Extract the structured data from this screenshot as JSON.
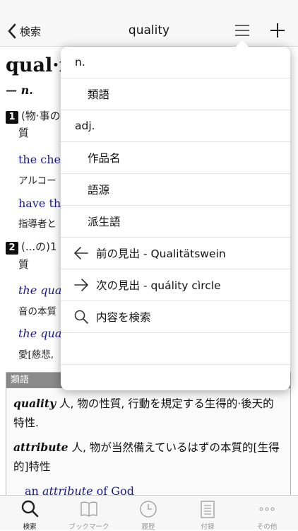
{
  "navbar": {
    "back_label": "検索",
    "title": "quality"
  },
  "entry": {
    "headword": "qual·i",
    "pos": "— n.",
    "sense1_num": "1",
    "sense1_text": "(物·事の",
    "sense1_cont": "質",
    "ex1_en": "the chem",
    "ex1_ja": "アルコー",
    "ex2_en": "have the",
    "ex2_ja": "指導者と",
    "sense2_num": "2",
    "sense2_text": "(...の)1",
    "sense2_cont": "質",
    "ex3_en": "the qual",
    "ex3_ja": "音の本質",
    "ex4_en": "the qual",
    "ex4_ja": "愛[慈悲,"
  },
  "synonyms": {
    "heading": "類語",
    "p1_word": "quality",
    "p1_text": " 人, 物の性質, 行動を規定する生得的·後天的特性.",
    "p2_word": "attribute",
    "p2_text": " 人, 物が当然備えているはずの本質的[生得的]特性",
    "ex_pre": "an ",
    "ex_italic": "attribute",
    "ex_post": " of God"
  },
  "popover": {
    "items": [
      {
        "label": "n."
      },
      {
        "label": "類語"
      },
      {
        "label": "adj."
      },
      {
        "label": "作品名"
      },
      {
        "label": "語源"
      },
      {
        "label": "派生語"
      },
      {
        "label": "前の見出 - Qualitätswein"
      },
      {
        "label": "次の見出 - quálity cìrcle"
      },
      {
        "label": "内容を検索"
      }
    ]
  },
  "tabbar": {
    "tabs": [
      {
        "label": "検索"
      },
      {
        "label": "ブックマーク"
      },
      {
        "label": "履歴"
      },
      {
        "label": "付録"
      },
      {
        "label": "その他"
      }
    ]
  },
  "colors": {
    "example_text": "#1a1a8a",
    "synonym_header_bg": "#8a8a8a"
  }
}
